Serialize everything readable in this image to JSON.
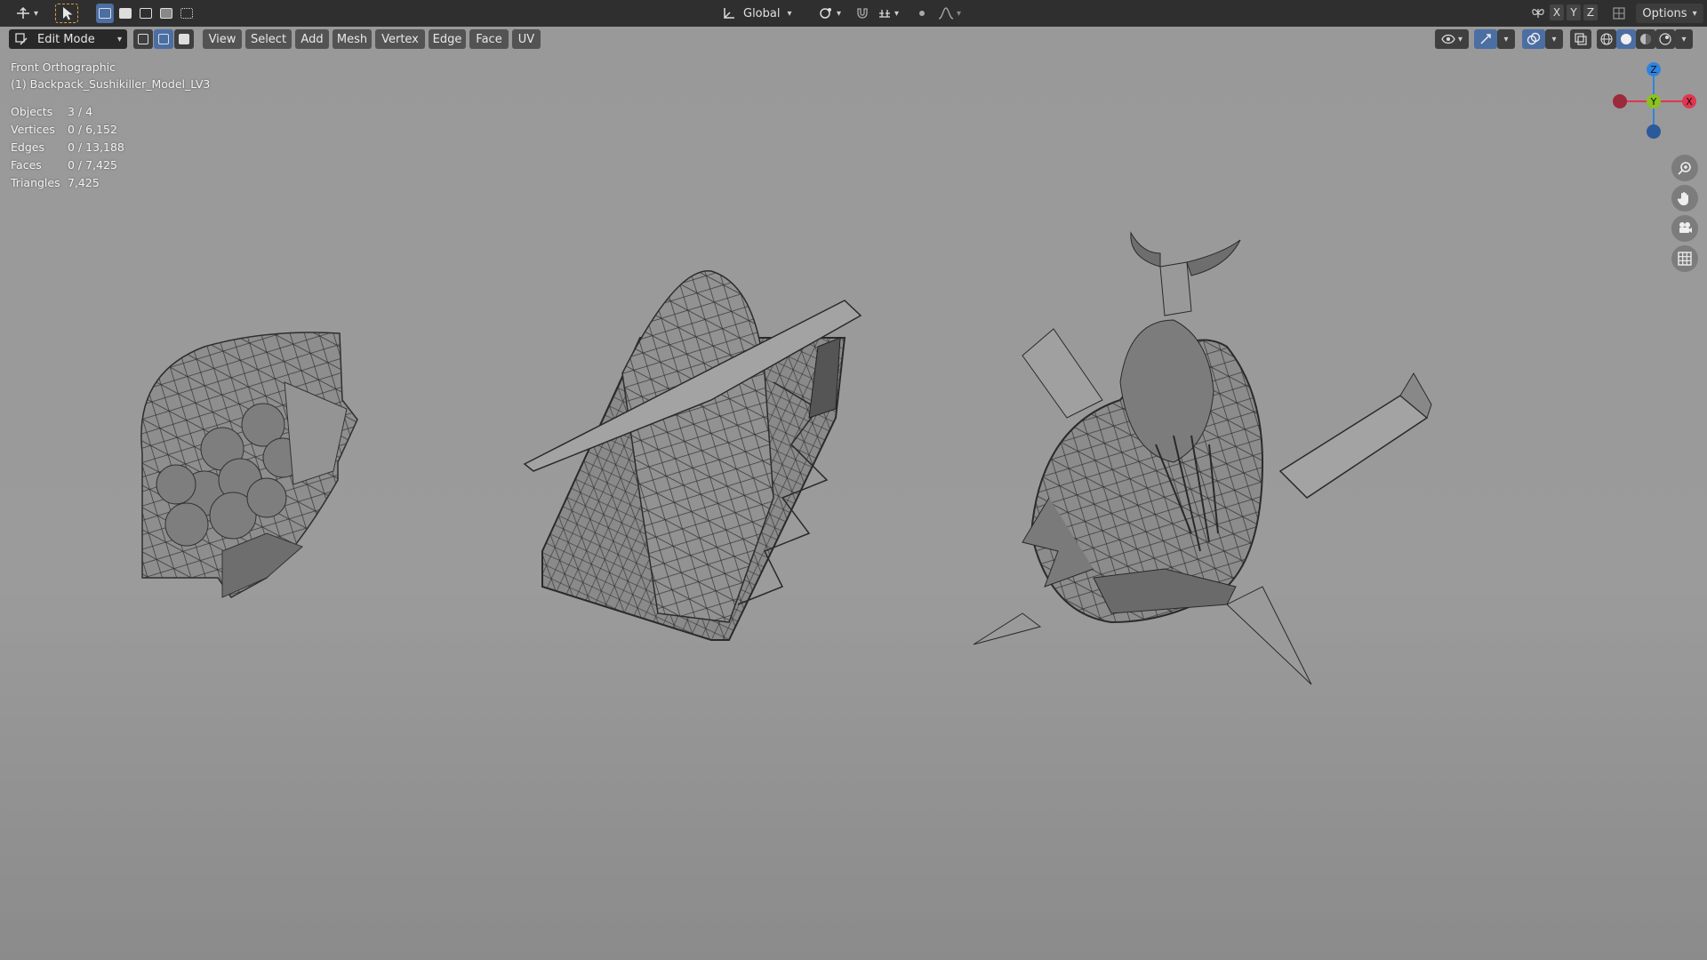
{
  "toolbar": {
    "orientation": "Global",
    "axes": [
      "X",
      "Y",
      "Z"
    ],
    "options_label": "Options"
  },
  "header": {
    "mode": "Edit Mode",
    "menus": [
      "View",
      "Select",
      "Add",
      "Mesh",
      "Vertex",
      "Edge",
      "Face",
      "UV"
    ]
  },
  "overlay": {
    "view_name": "Front Orthographic",
    "object_name": "(1) Backpack_Sushikiller_Model_LV3",
    "stats": [
      {
        "label": "Objects",
        "value": "3 / 4"
      },
      {
        "label": "Vertices",
        "value": "0 / 6,152"
      },
      {
        "label": "Edges",
        "value": "0 / 13,188"
      },
      {
        "label": "Faces",
        "value": "0 / 7,425"
      },
      {
        "label": "Triangles",
        "value": "7,425"
      }
    ]
  },
  "gizmo": {
    "z_label": "Z",
    "y_label": "Y",
    "x_label": "X",
    "colors": {
      "x": "#e0364f",
      "y": "#8bc220",
      "z": "#2f83e0"
    }
  },
  "icons": {
    "left_tools": [
      "transform-icon",
      "select-cursor-icon",
      "select-box-icon",
      "select-extend-icon",
      "select-subtract-icon",
      "select-invert-icon",
      "select-intersect-icon"
    ],
    "nav": [
      "zoom-icon",
      "pan-hand-icon",
      "camera-icon",
      "grid-icon"
    ]
  }
}
